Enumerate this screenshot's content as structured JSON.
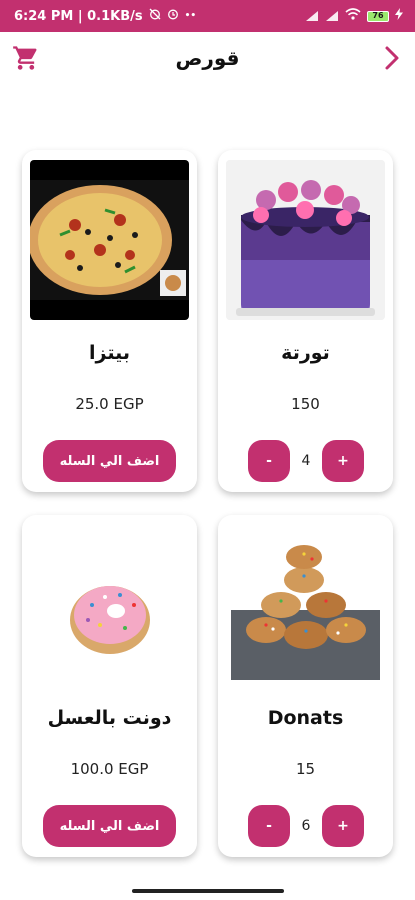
{
  "status_bar": {
    "time": "6:24 PM | 0.1KB/s",
    "battery": "76"
  },
  "app_bar": {
    "title": "قورص"
  },
  "products": [
    {
      "name": "بيتزا",
      "price": "25.0 EGP",
      "add_label": "اضف الي السله",
      "image": "pizza"
    },
    {
      "name": "تورتة",
      "price": "150",
      "quantity": "4",
      "minus": "-",
      "plus": "+",
      "image": "cake"
    },
    {
      "name": "دونت بالعسل",
      "price": "100.0 EGP",
      "add_label": "اضف الي السله",
      "image": "donut"
    },
    {
      "name": "Donats",
      "price": "15",
      "quantity": "6",
      "minus": "-",
      "plus": "+",
      "image": "donuts-pile"
    }
  ],
  "colors": {
    "accent": "#c2306f",
    "background": "#ffffff"
  },
  "icons": [
    "cart-icon",
    "chevron-right-icon"
  ]
}
